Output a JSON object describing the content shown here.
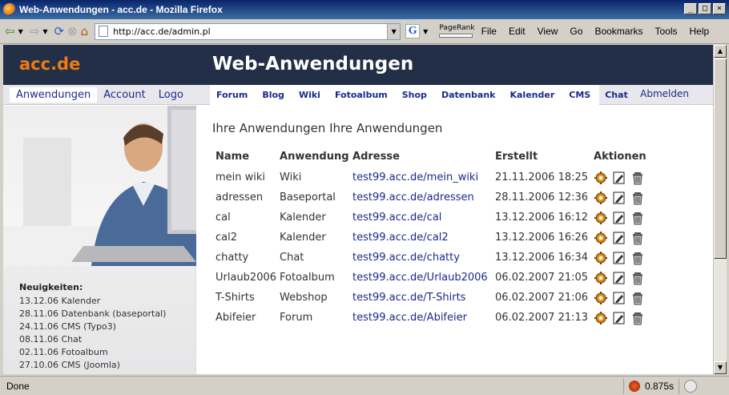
{
  "window": {
    "title": "Web-Anwendungen - acc.de - Mozilla Firefox"
  },
  "browser": {
    "url": "http://acc.de/admin.pl",
    "pagerank_label": "PageRank",
    "menu": [
      "File",
      "Edit",
      "View",
      "Go",
      "Bookmarks",
      "Tools",
      "Help"
    ]
  },
  "site": {
    "logo": "acc.de",
    "title": "Web-Anwendungen",
    "left_nav": [
      "Anwendungen",
      "Account",
      "Logo"
    ],
    "app_nav": [
      "Forum",
      "Blog",
      "Wiki",
      "Fotoalbum",
      "Shop",
      "Datenbank",
      "Kalender",
      "CMS",
      "Chat"
    ],
    "logout": "Abmelden"
  },
  "sidebar": {
    "news_title": "Neuigkeiten:",
    "news": [
      "13.12.06 Kalender",
      "28.11.06 Datenbank (baseportal)",
      "24.11.06 CMS (Typo3)",
      "08.11.06 Chat",
      "02.11.06 Fotoalbum",
      "27.10.06 CMS (Joomla)"
    ]
  },
  "main": {
    "heading": "Ihre Anwendungen Ihre Anwendungen",
    "columns": [
      "Name",
      "Anwendung",
      "Adresse",
      "Erstellt",
      "Aktionen"
    ],
    "rows": [
      {
        "name": "mein wiki",
        "app": "Wiki",
        "address": "test99.acc.de/mein_wiki",
        "created": "21.11.2006 18:25"
      },
      {
        "name": "adressen",
        "app": "Baseportal",
        "address": "test99.acc.de/adressen",
        "created": "28.11.2006 12:36"
      },
      {
        "name": "cal",
        "app": "Kalender",
        "address": "test99.acc.de/cal",
        "created": "13.12.2006 16:12"
      },
      {
        "name": "cal2",
        "app": "Kalender",
        "address": "test99.acc.de/cal2",
        "created": "13.12.2006 16:26"
      },
      {
        "name": "chatty",
        "app": "Chat",
        "address": "test99.acc.de/chatty",
        "created": "13.12.2006 16:34"
      },
      {
        "name": "Urlaub2006",
        "app": "Fotoalbum",
        "address": "test99.acc.de/Urlaub2006",
        "created": "06.02.2007 21:05"
      },
      {
        "name": "T-Shirts",
        "app": "Webshop",
        "address": "test99.acc.de/T-Shirts",
        "created": "06.02.2007 21:06"
      },
      {
        "name": "Abifeier",
        "app": "Forum",
        "address": "test99.acc.de/Abifeier",
        "created": "06.02.2007 21:13"
      }
    ]
  },
  "status": {
    "text": "Done",
    "timing": "0.875s"
  }
}
